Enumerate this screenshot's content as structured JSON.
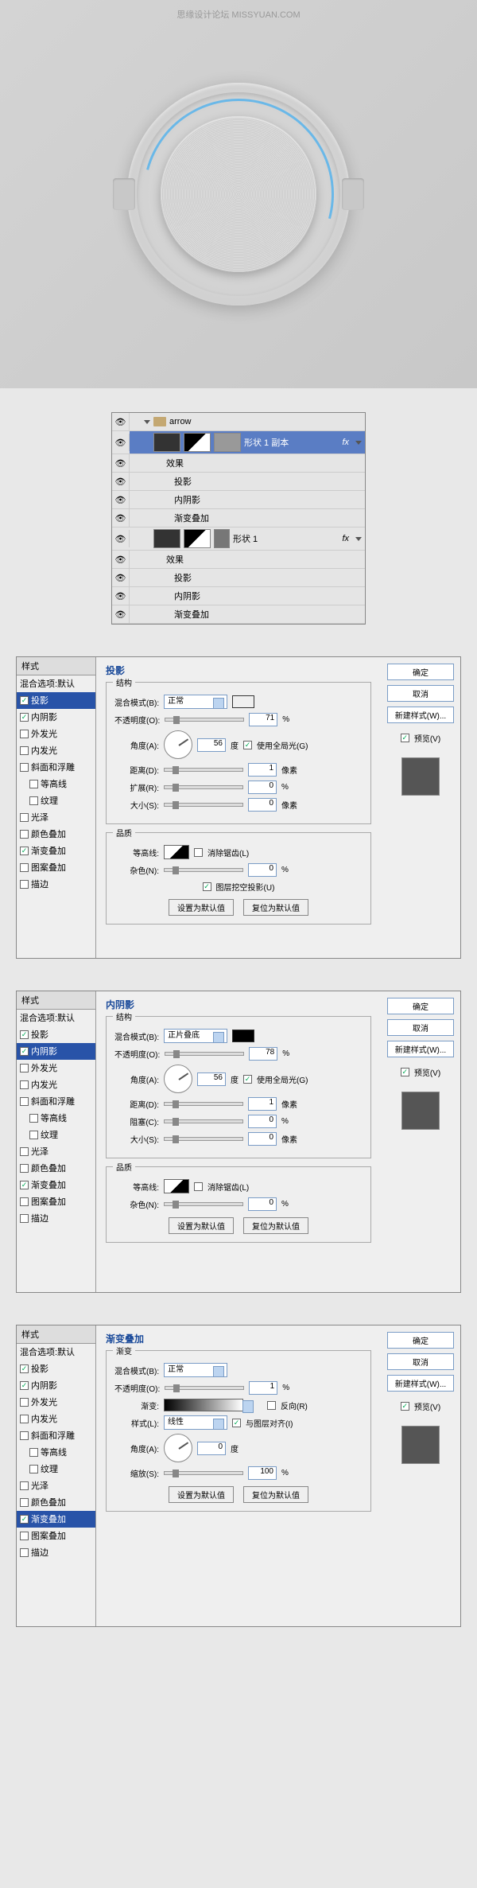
{
  "watermark": "思缘设计论坛  MISSYUAN.COM",
  "layers": {
    "group_name": "arrow",
    "layer1_name": "形状 1 副本",
    "layer2_name": "形状 1",
    "effects_label": "效果",
    "fx_label": "fx",
    "eff_dropshadow": "投影",
    "eff_innershadow": "内阴影",
    "eff_gradient": "渐变叠加"
  },
  "common": {
    "styles_header": "样式",
    "blending_default": "混合选项:默认",
    "s_dropshadow": "投影",
    "s_innershadow": "内阴影",
    "s_outerglow": "外发光",
    "s_innerglow": "内发光",
    "s_bevel": "斜面和浮雕",
    "s_contour": "等高线",
    "s_texture": "纹理",
    "s_satin": "光泽",
    "s_coloroverlay": "颜色叠加",
    "s_gradientoverlay": "渐变叠加",
    "s_patternoverlay": "图案叠加",
    "s_stroke": "描边",
    "btn_ok": "确定",
    "btn_cancel": "取消",
    "btn_newstyle": "新建样式(W)...",
    "preview": "预览(V)",
    "struct": "结构",
    "quality": "品质",
    "gradient_sect": "渐变",
    "blend_mode": "混合模式(B):",
    "opacity": "不透明度(O):",
    "angle": "角度(A):",
    "degree": "度",
    "use_global": "使用全局光(G)",
    "distance": "距离(D):",
    "spread": "扩展(R):",
    "choke": "阻塞(C):",
    "size": "大小(S):",
    "px": "像素",
    "pct": "%",
    "contour_lbl": "等高线:",
    "antialias": "消除锯齿(L)",
    "noise": "杂色(N):",
    "knockout": "图层挖空投影(U)",
    "set_default": "设置为默认值",
    "reset_default": "复位为默认值",
    "gradient_lbl": "渐变:",
    "reverse": "反向(R)",
    "style_lbl": "样式(L):",
    "align_layer": "与图层对齐(I)",
    "scale": "缩放(S):"
  },
  "d1": {
    "title": "投影",
    "mode": "正常",
    "opacity": "71",
    "angle": "56",
    "distance": "1",
    "spread": "0",
    "size": "0",
    "noise": "0",
    "color": "#000000"
  },
  "d2": {
    "title": "内阴影",
    "mode": "正片叠底",
    "opacity": "78",
    "angle": "56",
    "distance": "1",
    "choke": "0",
    "size": "0",
    "noise": "0",
    "color": "#000000"
  },
  "d3": {
    "title": "渐变叠加",
    "mode": "正常",
    "opacity": "1",
    "style": "线性",
    "angle": "0",
    "scale": "100"
  }
}
